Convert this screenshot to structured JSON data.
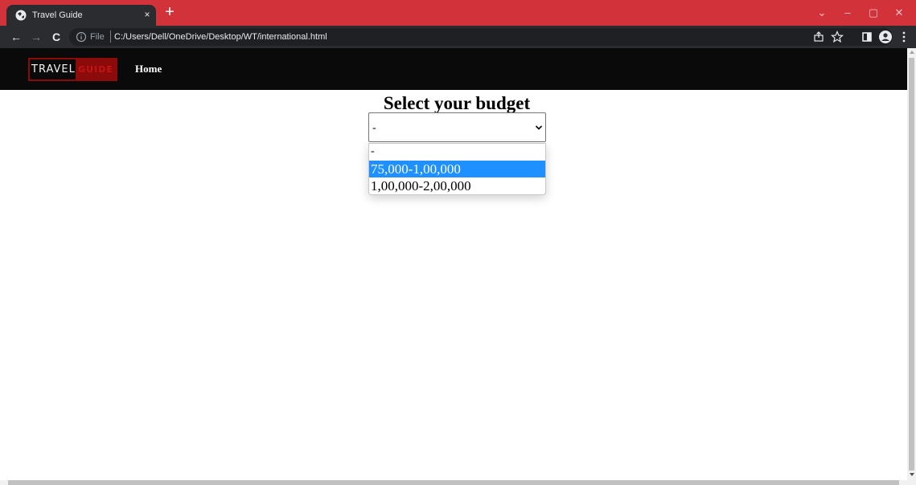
{
  "browser": {
    "tab_title": "Travel Guide",
    "tab_close": "×",
    "new_tab": "+",
    "window_controls": {
      "tab_search": "⌄",
      "minimize": "–",
      "maximize": "▢",
      "close": "✕"
    },
    "nav": {
      "back": "←",
      "forward": "→",
      "reload": "C"
    },
    "address": {
      "scheme_label": "File",
      "url": "C:/Users/Dell/OneDrive/Desktop/WT/international.html"
    },
    "colors": {
      "frame": "#d2323a",
      "toolbar": "#2a2c30",
      "omnibox": "#1f2023"
    }
  },
  "site": {
    "logo": {
      "part1": "TRAVEL",
      "part2": "GUIDE"
    },
    "nav_links": [
      {
        "label": "Home"
      }
    ],
    "colors": {
      "navbar": "#0a0a0a",
      "logo_accent": "#8b0a0a"
    }
  },
  "main": {
    "heading": "Select your budget",
    "budget_select": {
      "selected": "-",
      "options": [
        "-",
        "75,000-1,00,000",
        "1,00,000-2,00,000"
      ],
      "highlighted_index": 1,
      "highlight_color": "#1e90ff"
    }
  },
  "icons": {
    "favicon": "globe-icon",
    "info": "info-icon",
    "share": "share-icon",
    "bookmark": "star-icon",
    "side_panel": "side-panel-icon",
    "profile": "profile-icon",
    "menu": "kebab-menu-icon",
    "chevron": "chevron-down-icon"
  }
}
